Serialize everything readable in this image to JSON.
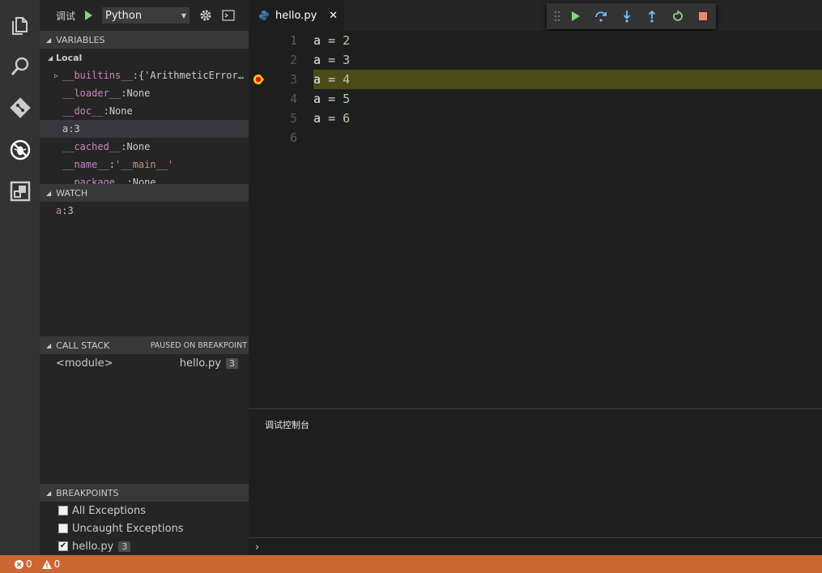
{
  "activity_icons": [
    "files-icon",
    "search-icon",
    "git-icon",
    "debug-icon",
    "extensions-icon"
  ],
  "debug_toolbar": {
    "label": "调试",
    "config": "Python"
  },
  "variables": {
    "title": "VARIABLES",
    "scope": "Local",
    "items": [
      {
        "name": "__builtins__",
        "value": "{'ArithmeticError…",
        "kind": "obj",
        "expandable": true
      },
      {
        "name": "__loader__",
        "value": "None",
        "kind": "none"
      },
      {
        "name": "__doc__",
        "value": "None",
        "kind": "none"
      },
      {
        "name": "a",
        "value": "3",
        "kind": "num"
      },
      {
        "name": "__cached__",
        "value": "None",
        "kind": "none"
      },
      {
        "name": "__name__",
        "value": "'__main__'",
        "kind": "str"
      },
      {
        "name": "__package__",
        "value": "None",
        "kind": "none"
      }
    ]
  },
  "watch": {
    "title": "WATCH",
    "items": [
      {
        "name": "a",
        "value": "3"
      }
    ]
  },
  "call_stack": {
    "title": "CALL STACK",
    "status": "PAUSED ON BREAKPOINT",
    "frames": [
      {
        "name": "<module>",
        "file": "hello.py",
        "line": "3"
      }
    ]
  },
  "breakpoints": {
    "title": "BREAKPOINTS",
    "items": [
      {
        "label": "All Exceptions",
        "checked": false
      },
      {
        "label": "Uncaught Exceptions",
        "checked": false
      },
      {
        "label": "hello.py",
        "checked": true,
        "line": "3"
      }
    ]
  },
  "editor": {
    "tab": {
      "filename": "hello.py",
      "close": "✕"
    },
    "lines": [
      {
        "num": "1",
        "var": "a",
        "op": "=",
        "val": "2"
      },
      {
        "num": "2",
        "var": "a",
        "op": "=",
        "val": "3"
      },
      {
        "num": "3",
        "var": "a",
        "op": "=",
        "val": "4",
        "current": true
      },
      {
        "num": "4",
        "var": "a",
        "op": "=",
        "val": "5"
      },
      {
        "num": "5",
        "var": "a",
        "op": "=",
        "val": "6"
      },
      {
        "num": "6",
        "var": "",
        "op": "",
        "val": ""
      }
    ]
  },
  "debug_controls": [
    "drag-handle-icon",
    "continue-icon",
    "step-over-icon",
    "step-into-icon",
    "step-out-icon",
    "restart-icon",
    "stop-icon"
  ],
  "panel": {
    "title": "调试控制台",
    "prompt": "›"
  },
  "status": {
    "errors": "0",
    "warnings": "0"
  },
  "colors": {
    "status_bar": "#cc6633",
    "current_line": "#4b4b18",
    "breakpoint": "#e51400",
    "continue": "#89d185"
  }
}
